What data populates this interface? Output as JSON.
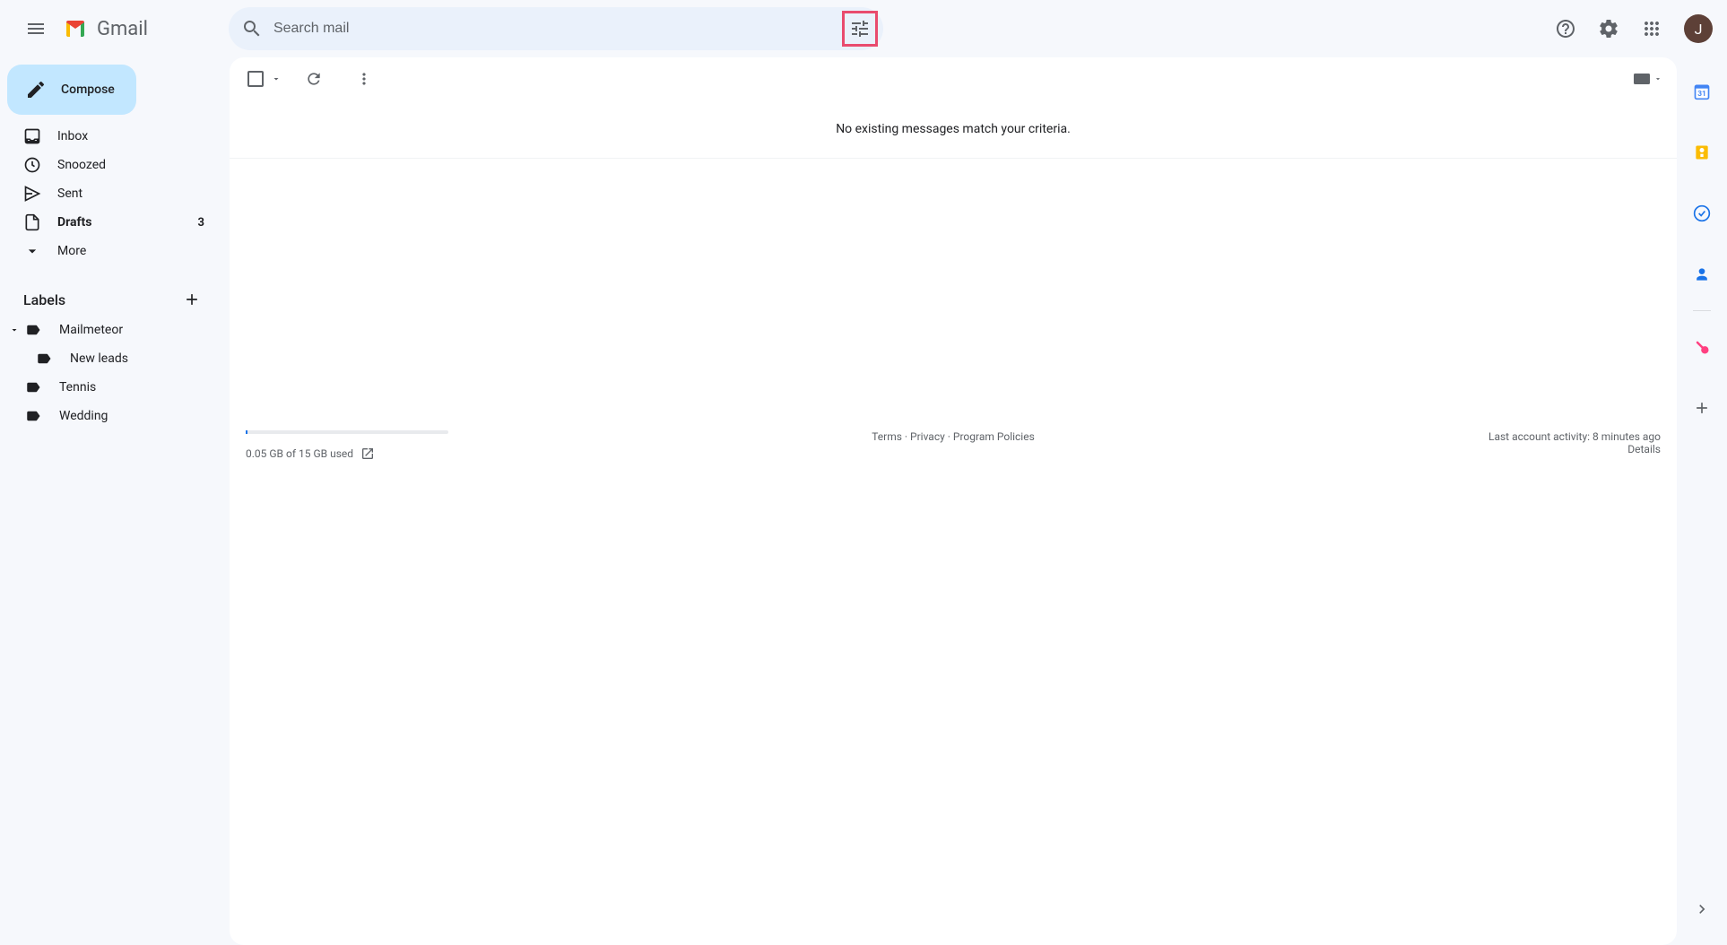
{
  "header": {
    "app_name": "Gmail",
    "search_placeholder": "Search mail",
    "avatar_initial": "J"
  },
  "sidebar": {
    "compose_label": "Compose",
    "nav_items": [
      {
        "label": "Inbox",
        "count": "",
        "bold": false
      },
      {
        "label": "Snoozed",
        "count": "",
        "bold": false
      },
      {
        "label": "Sent",
        "count": "",
        "bold": false
      },
      {
        "label": "Drafts",
        "count": "3",
        "bold": true
      },
      {
        "label": "More",
        "count": "",
        "bold": false
      }
    ],
    "labels_header": "Labels",
    "labels": [
      {
        "name": "Mailmeteor",
        "nested": false,
        "expandable": true
      },
      {
        "name": "New leads",
        "nested": true,
        "expandable": false
      },
      {
        "name": "Tennis",
        "nested": false,
        "expandable": false
      },
      {
        "name": "Wedding",
        "nested": false,
        "expandable": false
      }
    ]
  },
  "content": {
    "empty_message": "No existing messages match your criteria."
  },
  "footer": {
    "storage_text": "0.05 GB of 15 GB used",
    "terms": "Terms",
    "privacy": "Privacy",
    "policies": "Program Policies",
    "activity": "Last account activity: 8 minutes ago",
    "details": "Details"
  }
}
